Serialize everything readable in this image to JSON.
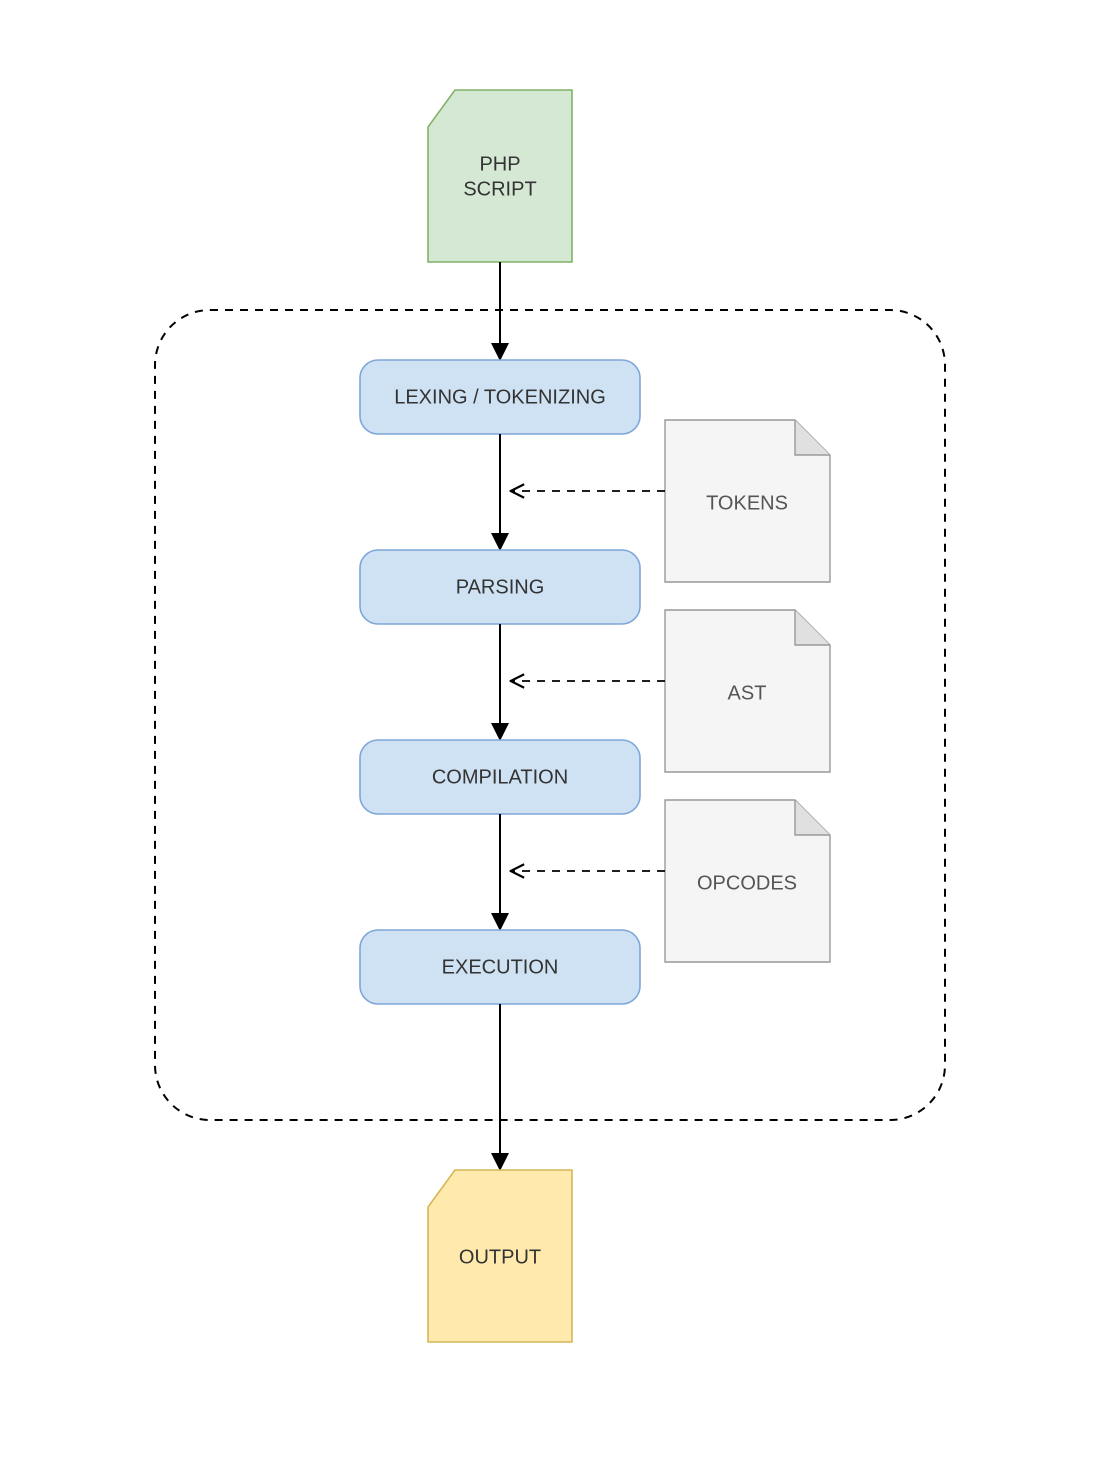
{
  "input_doc": {
    "line1": "PHP",
    "line2": "SCRIPT",
    "fill": "#d5e8d4",
    "stroke": "#82b366"
  },
  "output_doc": {
    "line1": "OUTPUT",
    "fill": "#ffe9ad",
    "stroke": "#d6b656"
  },
  "stages": [
    {
      "label": "LEXING / TOKENIZING"
    },
    {
      "label": "PARSING"
    },
    {
      "label": "COMPILATION"
    },
    {
      "label": "EXECUTION"
    }
  ],
  "side_notes": [
    {
      "label": "TOKENS"
    },
    {
      "label": "AST"
    },
    {
      "label": "OPCODES"
    }
  ],
  "colors": {
    "stage_fill": "#cfe2f3",
    "stage_stroke": "#7ea6d9",
    "note_fill": "#f5f5f5",
    "note_stroke": "#999999",
    "container_stroke": "#000000"
  }
}
